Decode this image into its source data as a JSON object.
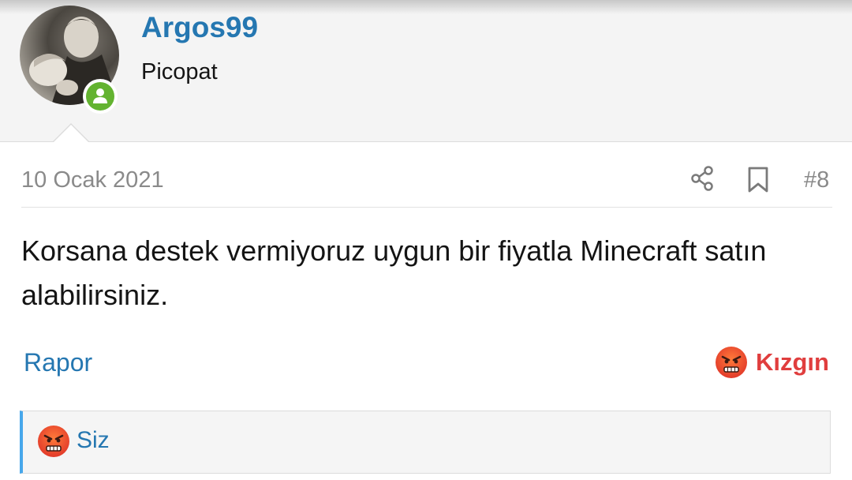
{
  "user": {
    "name": "Argos99",
    "title": "Picopat",
    "avatar_icon": "avatar-photo",
    "status_icon": "online-user-icon"
  },
  "post": {
    "date": "10 Ocak 2021",
    "number": "#8",
    "body": "Korsana destek vermiyoruz uygun bir fiyatla Minecraft satın alabilirsiniz.",
    "actions": {
      "share_icon": "share-icon",
      "bookmark_icon": "bookmark-icon"
    }
  },
  "footer": {
    "report_label": "Rapor",
    "reaction_label": "Kızgın",
    "reaction_icon": "angry-face-icon"
  },
  "reactions_bar": {
    "reactor": "Siz",
    "reaction_icon": "angry-face-icon"
  },
  "colors": {
    "link": "#2577b1",
    "angry": "#e03e3e",
    "online": "#63b330",
    "accent_border": "#47a7eb"
  }
}
